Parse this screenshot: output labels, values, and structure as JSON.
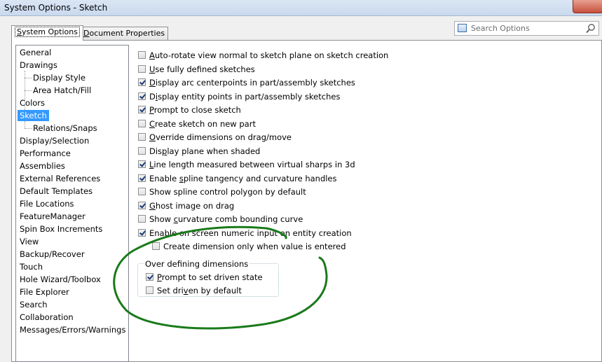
{
  "window": {
    "title": "System Options - Sketch"
  },
  "tabs": [
    {
      "label": "System Options",
      "accel": "S",
      "rest": "ystem Options",
      "active": true
    },
    {
      "label": "Document Properties",
      "accel": "D",
      "rest": "ocument Properties",
      "active": false
    }
  ],
  "search": {
    "placeholder": "Search Options",
    "icon": "magnifier-icon"
  },
  "sidebar": {
    "items": [
      {
        "label": "General",
        "indent": 0
      },
      {
        "label": "Drawings",
        "indent": 0
      },
      {
        "label": "Display Style",
        "indent": 1
      },
      {
        "label": "Area Hatch/Fill",
        "indent": 1
      },
      {
        "label": "Colors",
        "indent": 0
      },
      {
        "label": "Sketch",
        "indent": 0,
        "selected": true
      },
      {
        "label": "Relations/Snaps",
        "indent": 1
      },
      {
        "label": "Display/Selection",
        "indent": 0
      },
      {
        "label": "Performance",
        "indent": 0
      },
      {
        "label": "Assemblies",
        "indent": 0
      },
      {
        "label": "External References",
        "indent": 0
      },
      {
        "label": "Default Templates",
        "indent": 0
      },
      {
        "label": "File Locations",
        "indent": 0
      },
      {
        "label": "FeatureManager",
        "indent": 0
      },
      {
        "label": "Spin Box Increments",
        "indent": 0
      },
      {
        "label": "View",
        "indent": 0
      },
      {
        "label": "Backup/Recover",
        "indent": 0
      },
      {
        "label": "Touch",
        "indent": 0
      },
      {
        "label": "Hole Wizard/Toolbox",
        "indent": 0
      },
      {
        "label": "File Explorer",
        "indent": 0
      },
      {
        "label": "Search",
        "indent": 0
      },
      {
        "label": "Collaboration",
        "indent": 0
      },
      {
        "label": "Messages/Errors/Warnings",
        "indent": 0
      }
    ]
  },
  "options": [
    {
      "pre": "",
      "ul": "A",
      "post": "uto-rotate view normal to sketch plane on sketch creation",
      "checked": false
    },
    {
      "pre": "",
      "ul": "U",
      "post": "se fully defined sketches",
      "checked": false
    },
    {
      "pre": "",
      "ul": "D",
      "post": "isplay arc centerpoints in part/assembly sketches",
      "checked": true
    },
    {
      "pre": "D",
      "ul": "i",
      "post": "splay entity points in part/assembly sketches",
      "checked": true
    },
    {
      "pre": "",
      "ul": "P",
      "post": "rompt to close sketch",
      "checked": true
    },
    {
      "pre": "",
      "ul": "C",
      "post": "reate sketch on new part",
      "checked": false
    },
    {
      "pre": "",
      "ul": "O",
      "post": "verride dimensions on drag/move",
      "checked": false
    },
    {
      "pre": "Dis",
      "ul": "p",
      "post": "lay plane when shaded",
      "checked": false
    },
    {
      "pre": "",
      "ul": "L",
      "post": "ine length measured between virtual sharps in 3d",
      "checked": true
    },
    {
      "pre": "Enable ",
      "ul": "s",
      "post": "pline tangency and curvature handles",
      "checked": true
    },
    {
      "pre": "Show spline control polygon by default",
      "ul": "",
      "post": "",
      "checked": false
    },
    {
      "pre": "",
      "ul": "G",
      "post": "host image on drag",
      "checked": true
    },
    {
      "pre": "Show ",
      "ul": "c",
      "post": "urvature comb bounding curve",
      "checked": false
    },
    {
      "pre": "Enable on screen numeric input on entity creation",
      "ul": "",
      "post": "",
      "checked": true
    },
    {
      "pre": "Create dimension only when value is entered",
      "ul": "",
      "post": "",
      "checked": false,
      "indent": true
    }
  ],
  "over_defining": {
    "title": "Over defining dimensions",
    "items": [
      {
        "pre": "",
        "ul": "P",
        "post": "rompt to set driven state",
        "checked": true
      },
      {
        "pre": "Set dri",
        "ul": "v",
        "post": "en by default",
        "checked": false
      }
    ]
  },
  "annotation": {
    "color": "#1a7a1a"
  }
}
